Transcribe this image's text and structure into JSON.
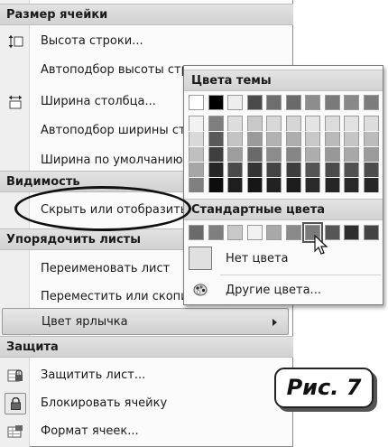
{
  "menu": {
    "sections": [
      {
        "title": "Размер ячейки"
      },
      {
        "title": "Видимость"
      },
      {
        "title": "Упорядочить листы"
      },
      {
        "title": "Защита"
      }
    ],
    "items": [
      {
        "label": "Высота строки...",
        "icon": "row-height-icon"
      },
      {
        "label": "Автоподбор высоты стр",
        "icon": ""
      },
      {
        "label": "Ширина столбца...",
        "icon": "column-width-icon"
      },
      {
        "label": "Автоподбор ширины ст",
        "icon": ""
      },
      {
        "label": "Ширина по умолчанию...",
        "icon": ""
      },
      {
        "label": "Скрыть или отобразить",
        "icon": ""
      },
      {
        "label": "Переименовать лист",
        "icon": ""
      },
      {
        "label": "Переместить или скопир",
        "icon": ""
      },
      {
        "label": "Цвет ярлычка",
        "icon": "",
        "has_submenu": true
      },
      {
        "label": "Защитить лист...",
        "icon": "protect-sheet-icon"
      },
      {
        "label": "Блокировать ячейку",
        "icon": "lock-icon"
      },
      {
        "label": "Формат ячеек...",
        "icon": "format-cells-icon"
      }
    ]
  },
  "color_popup": {
    "theme_header": "Цвета темы",
    "standard_header": "Стандартные цвета",
    "no_color_label": "Нет цвета",
    "more_colors_label": "Другие цвета...",
    "theme_top_row": [
      "#ffffff",
      "#000000",
      "#eeeeee",
      "#4a4a4a",
      "#6e6e6e",
      "#6a6a6a",
      "#8c8c8c",
      "#7a7a7a",
      "#888888",
      "#7c7c7c"
    ],
    "theme_tints": [
      [
        "#f2f2f2",
        "#d9d9d9",
        "#bfbfbf",
        "#a6a6a6",
        "#808080"
      ],
      [
        "#7f7f7f",
        "#595959",
        "#3f3f3f",
        "#262626",
        "#0d0d0d"
      ],
      [
        "#dddddd",
        "#c4c4c4",
        "#9e9e9e",
        "#4a4a4a",
        "#1e1e1e"
      ],
      [
        "#c9c9c9",
        "#9a9a9a",
        "#6a6a6a",
        "#333333",
        "#161616"
      ],
      [
        "#d8d8d8",
        "#b2b2b2",
        "#8c8c8c",
        "#444444",
        "#222222"
      ],
      [
        "#d6d6d6",
        "#aeaeae",
        "#868686",
        "#3d3d3d",
        "#1d1d1d"
      ],
      [
        "#e4e4e4",
        "#c8c8c8",
        "#adadad",
        "#545454",
        "#2a2a2a"
      ],
      [
        "#dcdcdc",
        "#bababa",
        "#989898",
        "#4b4b4b",
        "#252525"
      ],
      [
        "#e2e2e2",
        "#c5c5c5",
        "#a8a8a8",
        "#515151",
        "#282828"
      ],
      [
        "#dddddd",
        "#bcbcbc",
        "#9b9b9b",
        "#4c4c4c",
        "#262626"
      ]
    ],
    "standard_colors": [
      "#6a6a6a",
      "#7f7f7f",
      "#c8c8c8",
      "#f2f2f2",
      "#a8a8a8",
      "#8a8a8a",
      "#7a7a7a",
      "#555555",
      "#2e2e2e",
      "#444444"
    ],
    "selected_standard_index": 6
  },
  "caption": {
    "text": "Рис. 7"
  }
}
